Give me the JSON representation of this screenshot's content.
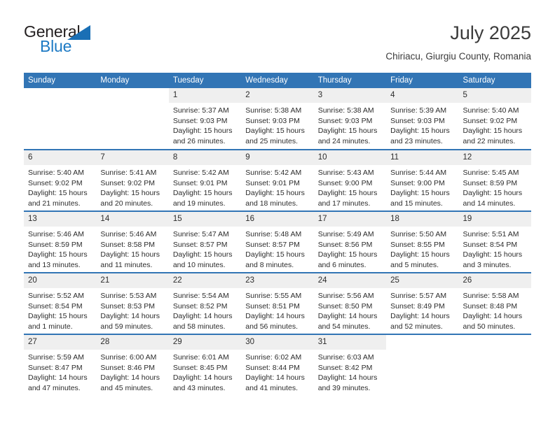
{
  "brand": {
    "name_part1": "General",
    "name_part2": "Blue",
    "triangle_color": "#1a6fb5",
    "accent_color": "#1d7ac4"
  },
  "header": {
    "title": "July 2025",
    "subtitle": "Chiriacu, Giurgiu County, Romania"
  },
  "theme": {
    "header_bg": "#3275b5",
    "header_text": "#ffffff",
    "daynum_bg": "#efefef",
    "body_text": "#2c2c2c",
    "page_bg": "#ffffff"
  },
  "calendar": {
    "weekday_headers": [
      "Sunday",
      "Monday",
      "Tuesday",
      "Wednesday",
      "Thursday",
      "Friday",
      "Saturday"
    ],
    "weeks": [
      [
        {
          "day": "",
          "lines": []
        },
        {
          "day": "",
          "lines": []
        },
        {
          "day": "1",
          "lines": [
            "Sunrise: 5:37 AM",
            "Sunset: 9:03 PM",
            "Daylight: 15 hours",
            "and 26 minutes."
          ]
        },
        {
          "day": "2",
          "lines": [
            "Sunrise: 5:38 AM",
            "Sunset: 9:03 PM",
            "Daylight: 15 hours",
            "and 25 minutes."
          ]
        },
        {
          "day": "3",
          "lines": [
            "Sunrise: 5:38 AM",
            "Sunset: 9:03 PM",
            "Daylight: 15 hours",
            "and 24 minutes."
          ]
        },
        {
          "day": "4",
          "lines": [
            "Sunrise: 5:39 AM",
            "Sunset: 9:03 PM",
            "Daylight: 15 hours",
            "and 23 minutes."
          ]
        },
        {
          "day": "5",
          "lines": [
            "Sunrise: 5:40 AM",
            "Sunset: 9:02 PM",
            "Daylight: 15 hours",
            "and 22 minutes."
          ]
        }
      ],
      [
        {
          "day": "6",
          "lines": [
            "Sunrise: 5:40 AM",
            "Sunset: 9:02 PM",
            "Daylight: 15 hours",
            "and 21 minutes."
          ]
        },
        {
          "day": "7",
          "lines": [
            "Sunrise: 5:41 AM",
            "Sunset: 9:02 PM",
            "Daylight: 15 hours",
            "and 20 minutes."
          ]
        },
        {
          "day": "8",
          "lines": [
            "Sunrise: 5:42 AM",
            "Sunset: 9:01 PM",
            "Daylight: 15 hours",
            "and 19 minutes."
          ]
        },
        {
          "day": "9",
          "lines": [
            "Sunrise: 5:42 AM",
            "Sunset: 9:01 PM",
            "Daylight: 15 hours",
            "and 18 minutes."
          ]
        },
        {
          "day": "10",
          "lines": [
            "Sunrise: 5:43 AM",
            "Sunset: 9:00 PM",
            "Daylight: 15 hours",
            "and 17 minutes."
          ]
        },
        {
          "day": "11",
          "lines": [
            "Sunrise: 5:44 AM",
            "Sunset: 9:00 PM",
            "Daylight: 15 hours",
            "and 15 minutes."
          ]
        },
        {
          "day": "12",
          "lines": [
            "Sunrise: 5:45 AM",
            "Sunset: 8:59 PM",
            "Daylight: 15 hours",
            "and 14 minutes."
          ]
        }
      ],
      [
        {
          "day": "13",
          "lines": [
            "Sunrise: 5:46 AM",
            "Sunset: 8:59 PM",
            "Daylight: 15 hours",
            "and 13 minutes."
          ]
        },
        {
          "day": "14",
          "lines": [
            "Sunrise: 5:46 AM",
            "Sunset: 8:58 PM",
            "Daylight: 15 hours",
            "and 11 minutes."
          ]
        },
        {
          "day": "15",
          "lines": [
            "Sunrise: 5:47 AM",
            "Sunset: 8:57 PM",
            "Daylight: 15 hours",
            "and 10 minutes."
          ]
        },
        {
          "day": "16",
          "lines": [
            "Sunrise: 5:48 AM",
            "Sunset: 8:57 PM",
            "Daylight: 15 hours",
            "and 8 minutes."
          ]
        },
        {
          "day": "17",
          "lines": [
            "Sunrise: 5:49 AM",
            "Sunset: 8:56 PM",
            "Daylight: 15 hours",
            "and 6 minutes."
          ]
        },
        {
          "day": "18",
          "lines": [
            "Sunrise: 5:50 AM",
            "Sunset: 8:55 PM",
            "Daylight: 15 hours",
            "and 5 minutes."
          ]
        },
        {
          "day": "19",
          "lines": [
            "Sunrise: 5:51 AM",
            "Sunset: 8:54 PM",
            "Daylight: 15 hours",
            "and 3 minutes."
          ]
        }
      ],
      [
        {
          "day": "20",
          "lines": [
            "Sunrise: 5:52 AM",
            "Sunset: 8:54 PM",
            "Daylight: 15 hours",
            "and 1 minute."
          ]
        },
        {
          "day": "21",
          "lines": [
            "Sunrise: 5:53 AM",
            "Sunset: 8:53 PM",
            "Daylight: 14 hours",
            "and 59 minutes."
          ]
        },
        {
          "day": "22",
          "lines": [
            "Sunrise: 5:54 AM",
            "Sunset: 8:52 PM",
            "Daylight: 14 hours",
            "and 58 minutes."
          ]
        },
        {
          "day": "23",
          "lines": [
            "Sunrise: 5:55 AM",
            "Sunset: 8:51 PM",
            "Daylight: 14 hours",
            "and 56 minutes."
          ]
        },
        {
          "day": "24",
          "lines": [
            "Sunrise: 5:56 AM",
            "Sunset: 8:50 PM",
            "Daylight: 14 hours",
            "and 54 minutes."
          ]
        },
        {
          "day": "25",
          "lines": [
            "Sunrise: 5:57 AM",
            "Sunset: 8:49 PM",
            "Daylight: 14 hours",
            "and 52 minutes."
          ]
        },
        {
          "day": "26",
          "lines": [
            "Sunrise: 5:58 AM",
            "Sunset: 8:48 PM",
            "Daylight: 14 hours",
            "and 50 minutes."
          ]
        }
      ],
      [
        {
          "day": "27",
          "lines": [
            "Sunrise: 5:59 AM",
            "Sunset: 8:47 PM",
            "Daylight: 14 hours",
            "and 47 minutes."
          ]
        },
        {
          "day": "28",
          "lines": [
            "Sunrise: 6:00 AM",
            "Sunset: 8:46 PM",
            "Daylight: 14 hours",
            "and 45 minutes."
          ]
        },
        {
          "day": "29",
          "lines": [
            "Sunrise: 6:01 AM",
            "Sunset: 8:45 PM",
            "Daylight: 14 hours",
            "and 43 minutes."
          ]
        },
        {
          "day": "30",
          "lines": [
            "Sunrise: 6:02 AM",
            "Sunset: 8:44 PM",
            "Daylight: 14 hours",
            "and 41 minutes."
          ]
        },
        {
          "day": "31",
          "lines": [
            "Sunrise: 6:03 AM",
            "Sunset: 8:42 PM",
            "Daylight: 14 hours",
            "and 39 minutes."
          ]
        },
        {
          "day": "",
          "lines": []
        },
        {
          "day": "",
          "lines": []
        }
      ]
    ]
  }
}
